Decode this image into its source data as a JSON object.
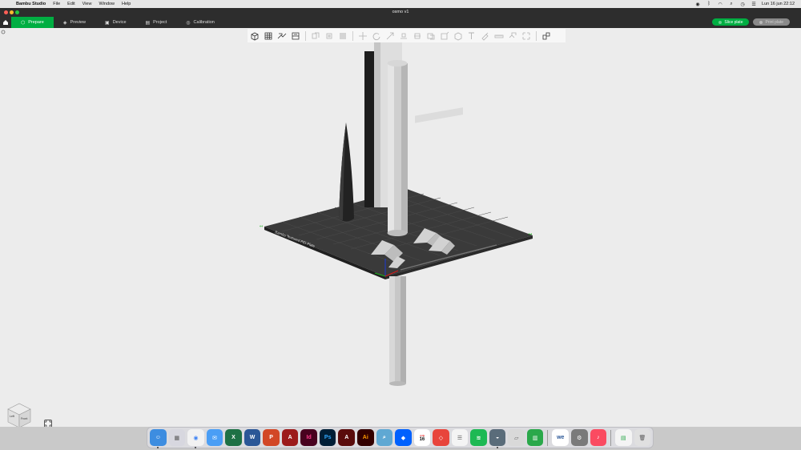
{
  "menubar": {
    "app_name": "Bambu Studio",
    "menus": [
      "File",
      "Edit",
      "View",
      "Window",
      "Help"
    ],
    "clock": "Lun 16 jun  22:12"
  },
  "window": {
    "title": "osmo v1"
  },
  "tabs": [
    {
      "label": "Prepare",
      "icon": "cube-icon",
      "active": true
    },
    {
      "label": "Preview",
      "icon": "layers-icon",
      "active": false
    },
    {
      "label": "Device",
      "icon": "printer-icon",
      "active": false
    },
    {
      "label": "Project",
      "icon": "project-icon",
      "active": false
    },
    {
      "label": "Calibration",
      "icon": "calibration-icon",
      "active": false
    }
  ],
  "actions": {
    "slice_label": "Slice plate",
    "print_label": "Print plate"
  },
  "toolbar": {
    "tools": [
      "add-object-icon",
      "grid-icon",
      "auto-arrange-icon",
      "plate-icon",
      "split-objects-icon",
      "split-parts-icon",
      "variable-layer-icon",
      "move-icon",
      "rotate-icon",
      "scale-icon",
      "lay-on-face-icon",
      "cut-icon",
      "mesh-boolean-icon",
      "support-paint-icon",
      "seam-paint-icon",
      "color-paint-icon",
      "text-icon",
      "measure-icon",
      "assembly-icon",
      "assemble-view-icon"
    ]
  },
  "plate": {
    "brand_label": "Bambu Textured PEI Plate"
  },
  "viewcube": {
    "left_label": "Left",
    "front_label": "Front"
  },
  "dock": {
    "calendar_month": "JUN",
    "calendar_day": "16",
    "apps": [
      "finder-icon",
      "launchpad-icon",
      "chrome-icon",
      "mail-icon",
      "excel-icon",
      "word-icon",
      "powerpoint-icon",
      "acrobat-icon",
      "indesign-icon",
      "photoshop-icon",
      "acrobat-reader-icon",
      "illustrator-icon",
      "preview-icon",
      "dropbox-icon",
      "calendar-icon",
      "remote-icon",
      "reminders-icon",
      "spotify-icon",
      "bambu-icon",
      "notes-icon",
      "numbers-icon",
      "wechat-icon",
      "system-settings-icon",
      "music-icon",
      "file-icon",
      "trash-icon"
    ]
  },
  "colors": {
    "accent": "#00ae42",
    "tab_bar": "#2d2d2d",
    "viewport": "#ececec"
  }
}
